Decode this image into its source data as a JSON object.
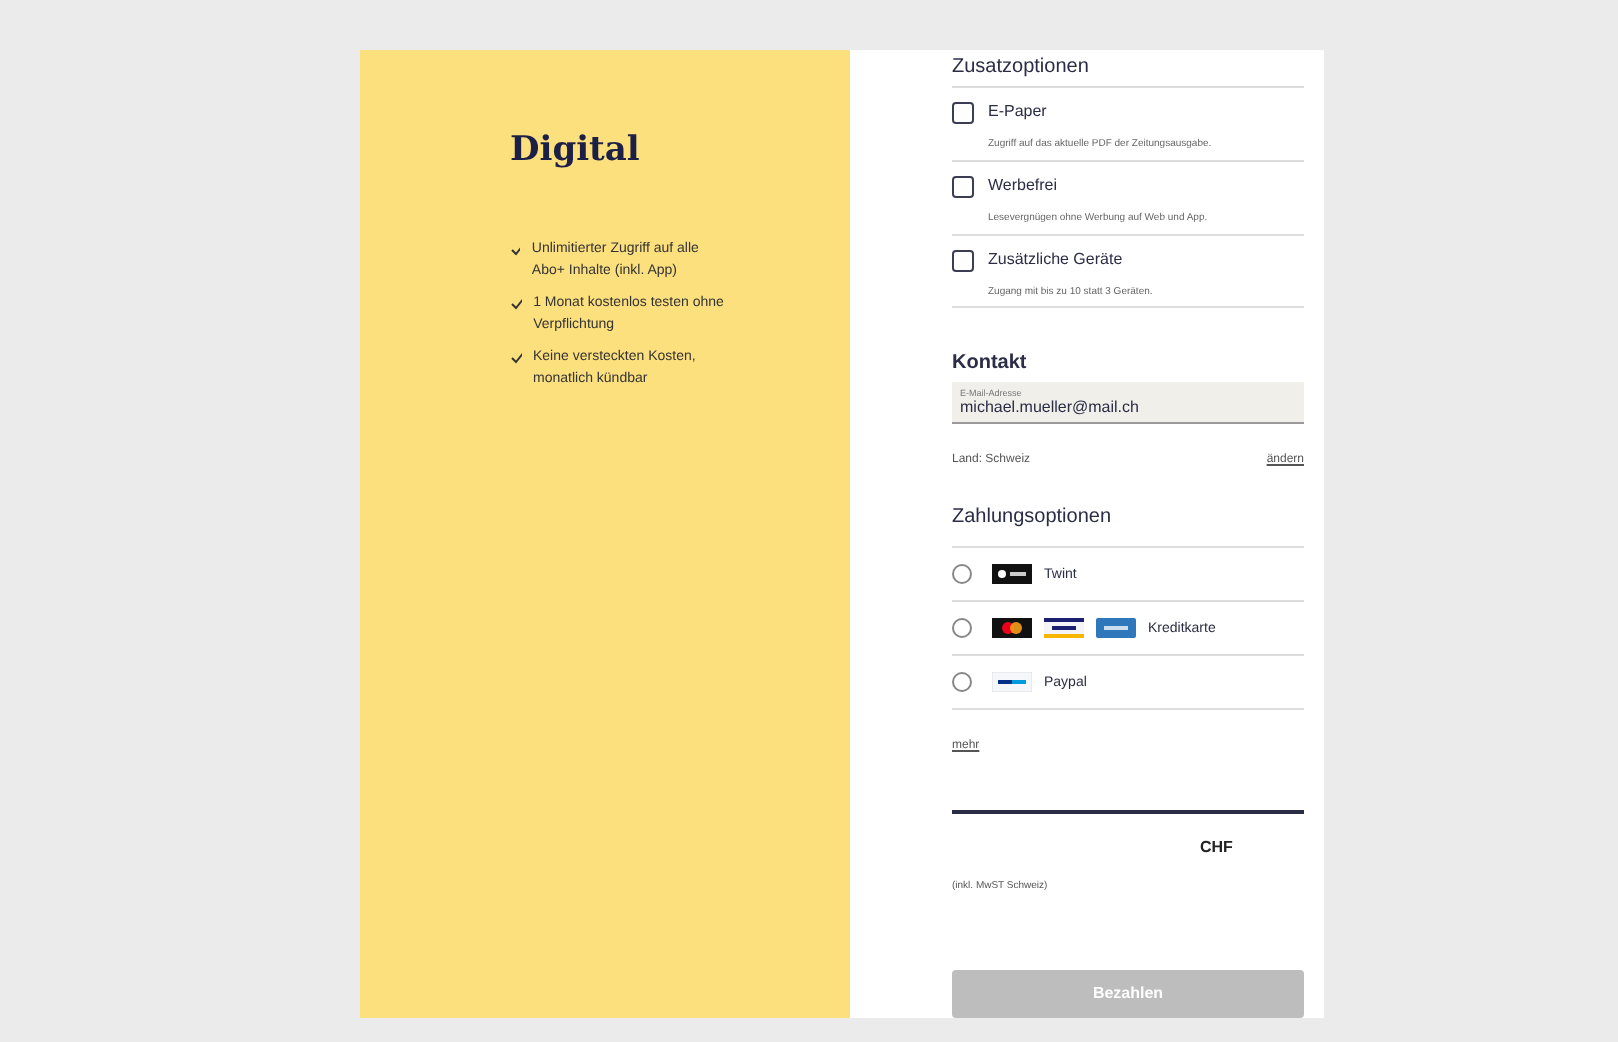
{
  "product": {
    "title": "Digital",
    "features": [
      "Unlimitierter Zugriff auf alle Abo+ Inhalte (inkl. App)",
      "1 Monat kostenlos testen ohne Verpflichtung",
      "Keine versteckten Kosten, monatlich kündbar"
    ]
  },
  "addons": {
    "title": "Zusatzoptionen",
    "items": [
      {
        "label": "E-Paper",
        "description": "Zugriff auf das aktuelle PDF der Zeitungsausgabe.",
        "checked": false
      },
      {
        "label": "Werbefrei",
        "description": "Lesevergnügen ohne Werbung auf Web und App.",
        "checked": false
      },
      {
        "label": "Zusätzliche Geräte",
        "description": "Zugang mit bis zu 10 statt 3 Geräten.",
        "checked": false
      }
    ]
  },
  "contact": {
    "title": "Kontakt",
    "email": {
      "label": "E-Mail-Adresse",
      "value": "michael.mueller@mail.ch"
    },
    "country": "Land: Schweiz",
    "change_link": "ändern"
  },
  "payment": {
    "title": "Zahlungsoptionen",
    "options": [
      {
        "label": "Twint",
        "kind": "twint",
        "selected": false
      },
      {
        "label": "Kreditkarte",
        "kind": "card",
        "selected": false
      },
      {
        "label": "Paypal",
        "kind": "paypal",
        "selected": false
      }
    ],
    "more_link": "mehr"
  },
  "total": {
    "currency": "CHF",
    "note": "(inkl. MwST Schweiz)"
  },
  "pay_button": {
    "label": "Bezahlen",
    "disabled": true
  }
}
